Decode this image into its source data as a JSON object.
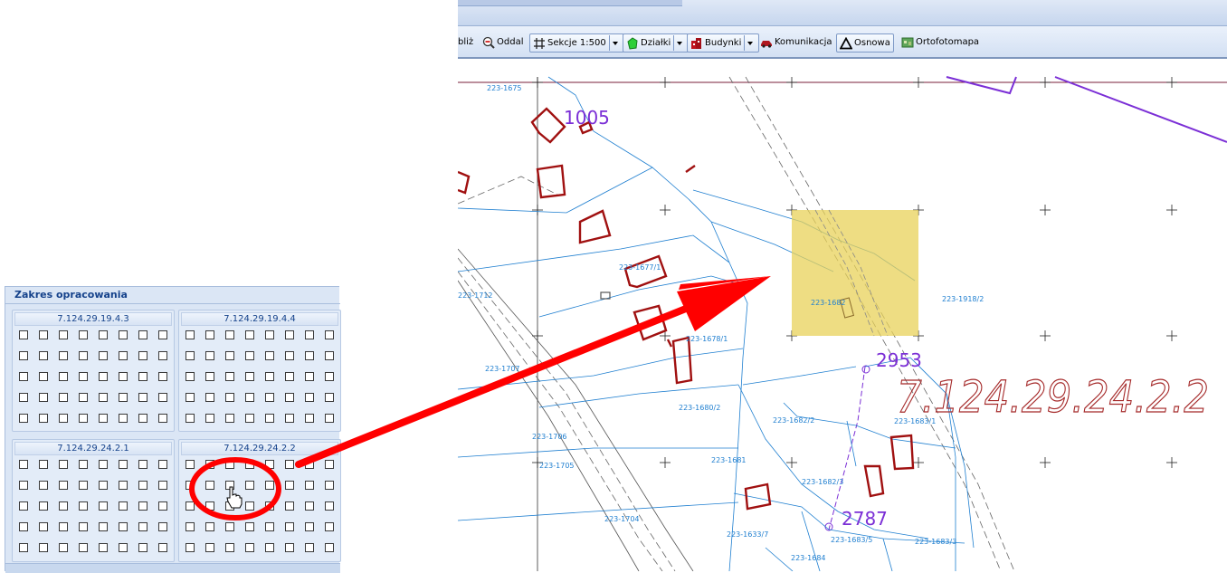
{
  "toolbar": {
    "zoom_in_label": "bliż",
    "zoom_out_label": "Oddal",
    "sections_label": "Sekcje 1:500",
    "parcels_label": "Działki",
    "buildings_label": "Budynki",
    "transport_label": "Komunikacja",
    "base_label": "Osnowa",
    "ortho_label": "Ortofotomapa"
  },
  "panel": {
    "title": "Zakres opracowania",
    "sections": [
      {
        "name": "7.124.29.19.4.3"
      },
      {
        "name": "7.124.29.19.4.4"
      },
      {
        "name": "7.124.29.24.2.1"
      },
      {
        "name": "7.124.29.24.2.2"
      }
    ]
  },
  "map": {
    "sheet_label": "7.124.29.24.2.2",
    "numbers": [
      "1005",
      "2953",
      "2787"
    ],
    "parcel_labels": [
      "223-1675",
      "223-1712",
      "223-1707",
      "223-1706",
      "223-1705",
      "223-1704",
      "223-1677/1",
      "223-1678/1",
      "223-1680/2",
      "223-1682/2",
      "223-1681",
      "223-1683/1",
      "223-1682/3",
      "223-1683/3",
      "223-1684",
      "223-1918/2",
      "223-1633/7",
      "223-1683/5",
      "223-1682"
    ]
  },
  "colors": {
    "accent_arrow": "#ff0000",
    "building": "#a01010",
    "parcel_line": "#1f7fd0",
    "highlight": "#e8d25a",
    "sheet_text": "#a52a2a",
    "number_text": "#7b2fd6"
  }
}
